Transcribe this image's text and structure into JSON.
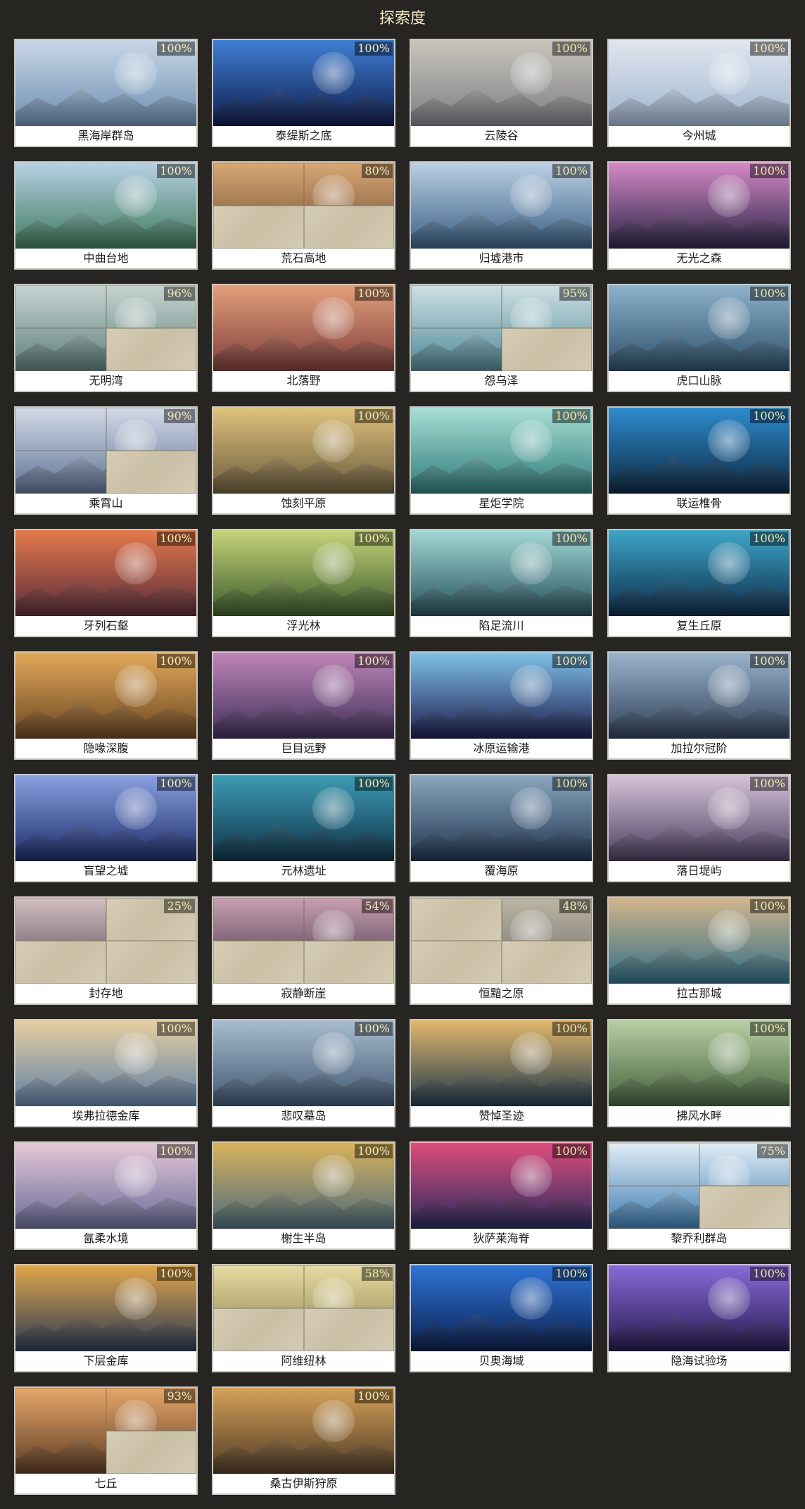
{
  "page": {
    "title": "探索度"
  },
  "regions": [
    {
      "name": "黑海岸群岛",
      "percent": "100%",
      "colors": [
        "#6d8fb2",
        "#c9d7e6"
      ]
    },
    {
      "name": "泰缇斯之底",
      "percent": "100%",
      "colors": [
        "#0f1d4a",
        "#3f7fd6"
      ]
    },
    {
      "name": "云陵谷",
      "percent": "100%",
      "colors": [
        "#7d7f86",
        "#c9c5bb"
      ]
    },
    {
      "name": "今州城",
      "percent": "100%",
      "colors": [
        "#9fb5cf",
        "#e0e6ef"
      ]
    },
    {
      "name": "中曲台地",
      "percent": "100%",
      "colors": [
        "#3f7a5a",
        "#b7d1e6"
      ]
    },
    {
      "name": "荒石高地",
      "percent": "80%",
      "colors": [
        "#6b4a2f",
        "#d9a874"
      ],
      "locked": [
        false,
        false,
        true,
        true
      ]
    },
    {
      "name": "归墟港市",
      "percent": "100%",
      "colors": [
        "#3a5f86",
        "#bcd0e3"
      ]
    },
    {
      "name": "无光之森",
      "percent": "100%",
      "colors": [
        "#2a2446",
        "#d489c6"
      ]
    },
    {
      "name": "无明湾",
      "percent": "96%",
      "colors": [
        "#5d7f7a",
        "#c7d5d2"
      ],
      "locked": [
        false,
        false,
        false,
        true
      ]
    },
    {
      "name": "北落野",
      "percent": "100%",
      "colors": [
        "#7d3d3a",
        "#e3a07c"
      ]
    },
    {
      "name": "怨乌泽",
      "percent": "95%",
      "colors": [
        "#4d8796",
        "#cfe1e5"
      ],
      "locked": [
        false,
        false,
        false,
        true
      ]
    },
    {
      "name": "虎口山脉",
      "percent": "100%",
      "colors": [
        "#2c4e6a",
        "#8fb3cc"
      ]
    },
    {
      "name": "乘霄山",
      "percent": "90%",
      "colors": [
        "#5e7294",
        "#d4dbe8"
      ],
      "locked": [
        false,
        false,
        false,
        true
      ]
    },
    {
      "name": "蚀刻平原",
      "percent": "100%",
      "colors": [
        "#6b5b3b",
        "#e0c27d"
      ]
    },
    {
      "name": "星炬学院",
      "percent": "100%",
      "colors": [
        "#2f7b7a",
        "#a9e0d6"
      ]
    },
    {
      "name": "联运椎骨",
      "percent": "100%",
      "colors": [
        "#0c2740",
        "#2f8ccf"
      ]
    },
    {
      "name": "牙列石壑",
      "percent": "100%",
      "colors": [
        "#5a2b3a",
        "#e57a4b"
      ]
    },
    {
      "name": "浮光林",
      "percent": "100%",
      "colors": [
        "#3b5a2a",
        "#c6d47a"
      ]
    },
    {
      "name": "陷足流川",
      "percent": "100%",
      "colors": [
        "#26505c",
        "#a3d9d6"
      ]
    },
    {
      "name": "复生丘原",
      "percent": "100%",
      "colors": [
        "#0d2a4a",
        "#3ea6c8"
      ]
    },
    {
      "name": "隐喙深腹",
      "percent": "100%",
      "colors": [
        "#6b4621",
        "#e2a85a"
      ]
    },
    {
      "name": "巨目远野",
      "percent": "100%",
      "colors": [
        "#3e2e5a",
        "#c086b8"
      ]
    },
    {
      "name": "冰原运输港",
      "percent": "100%",
      "colors": [
        "#1c1d4f",
        "#7fc1e8"
      ]
    },
    {
      "name": "加拉尔冠阶",
      "percent": "100%",
      "colors": [
        "#2e3f57",
        "#9ab4cc"
      ]
    },
    {
      "name": "盲望之墟",
      "percent": "100%",
      "colors": [
        "#1a2a6a",
        "#8aa0e0"
      ]
    },
    {
      "name": "元林遗址",
      "percent": "100%",
      "colors": [
        "#0e3247",
        "#3d9bb4"
      ]
    },
    {
      "name": "覆海原",
      "percent": "100%",
      "colors": [
        "#1f3350",
        "#8aa7bf"
      ]
    },
    {
      "name": "落日堤屿",
      "percent": "100%",
      "colors": [
        "#4a3d5e",
        "#d6c3d9"
      ]
    },
    {
      "name": "封存地",
      "percent": "25%",
      "colors": [
        "#4e4256",
        "#d3c0c0"
      ],
      "locked": [
        false,
        true,
        true,
        true
      ]
    },
    {
      "name": "寂静断崖",
      "percent": "54%",
      "colors": [
        "#3d2f44",
        "#c9a0b1"
      ],
      "locked": [
        false,
        false,
        true,
        true
      ]
    },
    {
      "name": "恒黯之原",
      "percent": "48%",
      "colors": [
        "#6b6a64",
        "#bcb6a6"
      ],
      "locked": [
        true,
        false,
        true,
        true
      ]
    },
    {
      "name": "拉古那城",
      "percent": "100%",
      "colors": [
        "#2f6d87",
        "#d3b58a"
      ]
    },
    {
      "name": "埃弗拉德金库",
      "percent": "100%",
      "colors": [
        "#5d7fa6",
        "#e8cfa0"
      ]
    },
    {
      "name": "悲叹墓岛",
      "percent": "100%",
      "colors": [
        "#3e5670",
        "#aabdd0"
      ]
    },
    {
      "name": "赞悼圣迹",
      "percent": "100%",
      "colors": [
        "#21384e",
        "#e2b76a"
      ]
    },
    {
      "name": "拂风水畔",
      "percent": "100%",
      "colors": [
        "#41603a",
        "#b9cfa4"
      ]
    },
    {
      "name": "氤柔水境",
      "percent": "100%",
      "colors": [
        "#6a6a9a",
        "#e6c9d8"
      ]
    },
    {
      "name": "榭生半岛",
      "percent": "100%",
      "colors": [
        "#4b6a7d",
        "#d9b35a"
      ]
    },
    {
      "name": "狄萨莱海脊",
      "percent": "100%",
      "colors": [
        "#262a5e",
        "#e04d7c"
      ]
    },
    {
      "name": "黎乔利群岛",
      "percent": "75%",
      "colors": [
        "#3d7bb0",
        "#e3eef6"
      ],
      "locked": [
        false,
        false,
        false,
        true
      ]
    },
    {
      "name": "下层金库",
      "percent": "100%",
      "colors": [
        "#2a3a54",
        "#e2a64a"
      ]
    },
    {
      "name": "阿维纽林",
      "percent": "58%",
      "colors": [
        "#8b7d4a",
        "#e6dba2"
      ],
      "locked": [
        false,
        false,
        true,
        true
      ]
    },
    {
      "name": "贝奥海域",
      "percent": "100%",
      "colors": [
        "#0b1f4d",
        "#2f74d6"
      ]
    },
    {
      "name": "隐海试验场",
      "percent": "100%",
      "colors": [
        "#241a4e",
        "#8a6ad8"
      ]
    },
    {
      "name": "七丘",
      "percent": "93%",
      "colors": [
        "#5e3a22",
        "#e6a86a"
      ],
      "locked": [
        false,
        false,
        false,
        true
      ]
    },
    {
      "name": "桑古伊斯狩原",
      "percent": "100%",
      "colors": [
        "#4f3a24",
        "#d6a25a"
      ]
    }
  ]
}
